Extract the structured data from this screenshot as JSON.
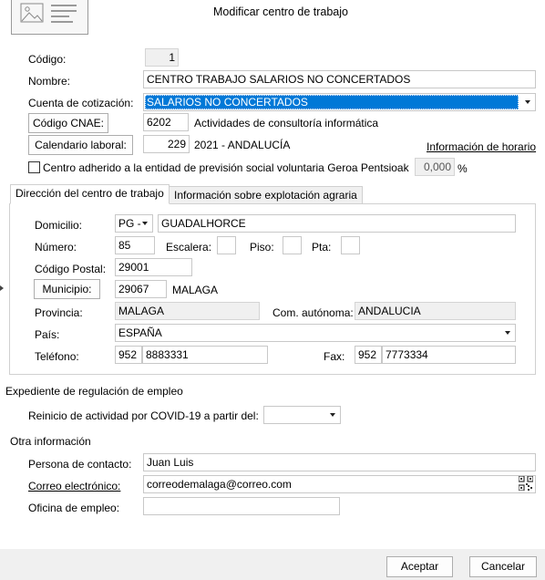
{
  "window": {
    "title": "Modificar centro de trabajo"
  },
  "form": {
    "codigo": {
      "label": "Código:",
      "value": "1"
    },
    "nombre": {
      "label": "Nombre:",
      "value": "CENTRO TRABAJO SALARIOS NO CONCERTADOS"
    },
    "cuenta": {
      "label": "Cuenta de cotización:",
      "value": "SALARIOS NO CONCERTADOS"
    },
    "cnae": {
      "button": "Código CNAE:",
      "code": "6202",
      "description": "Actividades de consultoría informática"
    },
    "calendario": {
      "button": "Calendario laboral:",
      "code": "229",
      "description": "2021 - ANDALUCÍA"
    },
    "info_horario": "Información de horario",
    "geroa": {
      "label": "Centro adherido a la entidad de previsión social voluntaria Geroa Pentsioak",
      "value": "0,000",
      "unit": "%"
    }
  },
  "tabs": [
    {
      "label": "Dirección del centro de trabajo",
      "active": true
    },
    {
      "label": "Información sobre explotación agraria",
      "active": false
    }
  ],
  "direccion": {
    "domicilio": {
      "label": "Domicilio:",
      "tipo": "PG -",
      "value": "GUADALHORCE"
    },
    "numero": {
      "label": "Número:",
      "value": "85"
    },
    "escalera": {
      "label": "Escalera:",
      "value": ""
    },
    "piso": {
      "label": "Piso:",
      "value": ""
    },
    "pta": {
      "label": "Pta:",
      "value": ""
    },
    "codigo_postal": {
      "label": "Código Postal:",
      "value": "29001"
    },
    "municipio": {
      "button": "Municipio:",
      "code": "29067",
      "name": "MALAGA"
    },
    "provincia": {
      "label": "Provincia:",
      "value": "MALAGA"
    },
    "com_autonoma": {
      "label": "Com. autónoma:",
      "value": "ANDALUCIA"
    },
    "pais": {
      "label": "País:",
      "value": "ESPAÑA"
    },
    "telefono": {
      "label": "Teléfono:",
      "prefix": "952",
      "value": "8883331"
    },
    "fax": {
      "label": "Fax:",
      "prefix": "952",
      "value": "7773334"
    }
  },
  "erte": {
    "heading": "Expediente de regulación de empleo",
    "reinicio": {
      "label": "Reinicio de actividad por COVID-19 a partir del:",
      "value": ""
    }
  },
  "otra": {
    "heading": "Otra información",
    "contacto": {
      "label": "Persona de contacto:",
      "value": "Juan Luis"
    },
    "correo": {
      "label": "Correo electrónico:",
      "value": "correodemalaga@correo.com"
    },
    "oficina": {
      "label": "Oficina de empleo:",
      "value": ""
    }
  },
  "footer": {
    "accept": "Aceptar",
    "cancel": "Cancelar"
  },
  "colors": {
    "selection": "#0078d7",
    "footer_bg": "#f0f0f0",
    "field_border": "#c8c8c8"
  }
}
